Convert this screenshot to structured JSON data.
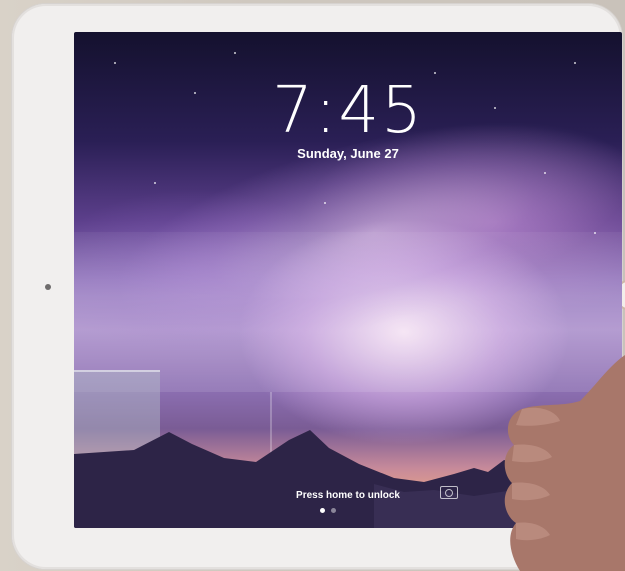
{
  "lock_screen": {
    "time": "7:45",
    "date": "Sunday, June 27",
    "unlock_hint": "Press home to unlock",
    "page_count": 2,
    "active_page": 1
  },
  "colors": {
    "device_frame": "#f1efee",
    "sky_top": "#14112e",
    "sky_mid": "#8a6cb7",
    "horizon_glow": "#e3a08a",
    "text": "#ffffff"
  },
  "icons": {
    "lock_camera": "camera-icon"
  }
}
